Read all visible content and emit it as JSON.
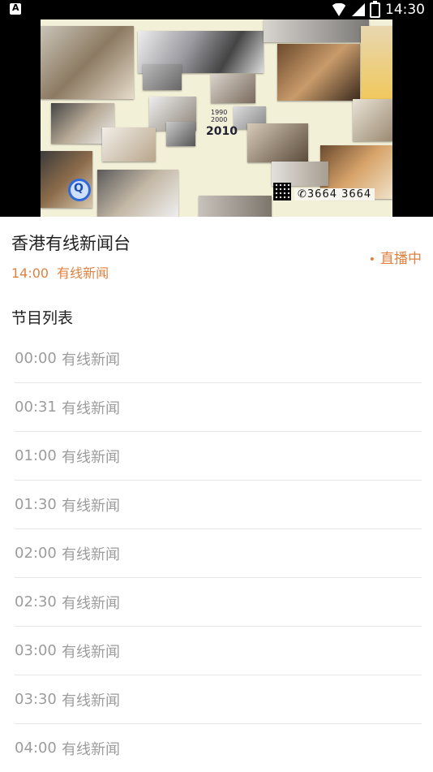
{
  "status_bar": {
    "time": "14:30"
  },
  "video": {
    "year_main": "2010",
    "year_small_1": "1990",
    "year_small_2": "2000",
    "hotline": "3664 3664"
  },
  "channel": {
    "name": "香港有线新闻台",
    "current_time": "14:00",
    "current_program": "有线新闻",
    "live_label": "直播中"
  },
  "program_list": {
    "title": "节目列表",
    "items": [
      {
        "time": "00:00",
        "name": "有线新闻"
      },
      {
        "time": "00:31",
        "name": "有线新闻"
      },
      {
        "time": "01:00",
        "name": "有线新闻"
      },
      {
        "time": "01:30",
        "name": "有线新闻"
      },
      {
        "time": "02:00",
        "name": "有线新闻"
      },
      {
        "time": "02:30",
        "name": "有线新闻"
      },
      {
        "time": "03:00",
        "name": "有线新闻"
      },
      {
        "time": "03:30",
        "name": "有线新闻"
      },
      {
        "time": "04:00",
        "name": "有线新闻"
      }
    ]
  },
  "colors": {
    "accent": "#e0813f",
    "muted_text": "#9c9c9c"
  }
}
